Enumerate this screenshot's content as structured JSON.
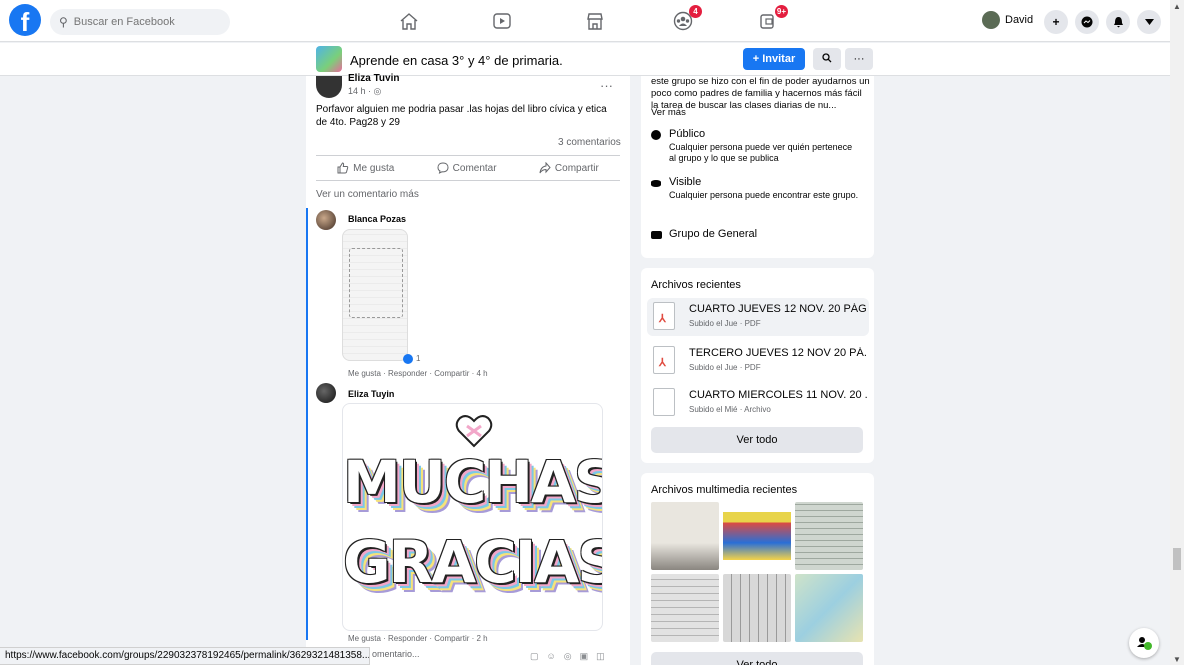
{
  "topnav": {
    "search_placeholder": "Buscar en Facebook",
    "groups_badge": "4",
    "gaming_badge": "9+",
    "profile_name": "David"
  },
  "group": {
    "name": "Aprende en casa 3° y 4° de primaria.",
    "invite_label": "+ Invitar",
    "more_label": "···"
  },
  "post": {
    "author": "Eliza Tuyin",
    "time": "14 h · ◎",
    "text": "Porfavor alguien me podria pasar .las hojas del libro cívica y etica de 4to. Pag28 y 29",
    "comments_count": "3 comentarios",
    "actions": {
      "like": "Me gusta",
      "comment": "Comentar",
      "share": "Compartir"
    },
    "more_comments": "Ver un comentario más"
  },
  "comments": [
    {
      "author": "Blanca Pozas",
      "reactions": "1",
      "actions": "Me gusta · Responder · Compartir · 4 h"
    },
    {
      "author": "Eliza Tuyin",
      "image_text_1": "MUCHAS",
      "image_text_2": "GRACIAS",
      "actions": "Me gusta · Responder · Compartir · 2 h"
    }
  ],
  "write_comment": "omentario...",
  "status_url": "https://www.facebook.com/groups/229032378192465/permalink/3629321481358...",
  "about": {
    "text": "este grupo se hizo con el fin de poder ayudarnos un poco como padres de familia y hacernos más fácil la tarea de buscar las clases diarias de nu...",
    "see_more": "Ver más",
    "public_title": "Público",
    "public_desc": "Cualquier persona puede ver quién pertenece al grupo y lo que se publica",
    "visible_title": "Visible",
    "visible_desc": "Cualquier persona puede encontrar este grupo.",
    "category": "Grupo de General"
  },
  "files": {
    "title": "Archivos recientes",
    "items": [
      {
        "name": "CUARTO JUEVES 12 NOV. 20 PÁG...",
        "meta": "Subido el Jue · PDF",
        "type": "pdf"
      },
      {
        "name": "TERCERO JUEVES 12 NOV 20 PÁ...",
        "meta": "Subido el Jue · PDF",
        "type": "pdf"
      },
      {
        "name": "CUARTO MIERCOLES 11 NOV. 20 ...",
        "meta": "Subido el Mié · Archivo",
        "type": "file"
      }
    ],
    "see_all": "Ver todo"
  },
  "media": {
    "title": "Archivos multimedia recientes",
    "see_all": "Ver todo"
  },
  "colors": {
    "brand": "#1877f2",
    "badge": "#e41e3f",
    "background": "#f0f2f5"
  }
}
